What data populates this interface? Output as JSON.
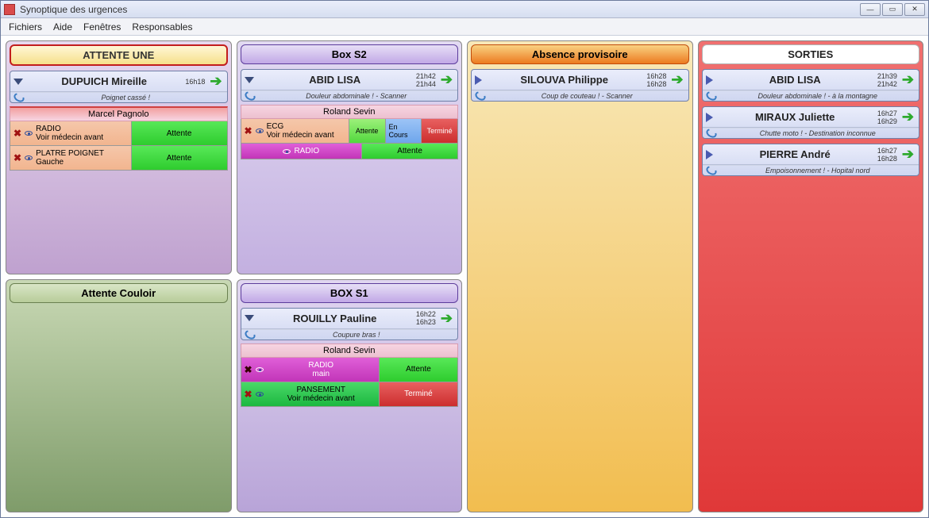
{
  "window": {
    "title": "Synoptique des urgences"
  },
  "menu": {
    "fichiers": "Fichiers",
    "aide": "Aide",
    "fenetres": "Fenêtres",
    "responsables": "Responsables"
  },
  "panels": {
    "attente_une": {
      "title": "ATTENTE UNE",
      "patient": {
        "name": "DUPUICH Mireille",
        "time1": "16h18",
        "detail": "Poignet cassé !"
      },
      "doctor": "Marcel Pagnolo",
      "tasks": [
        {
          "name": "RADIO",
          "sub": "Voir médecin avant",
          "status": "Attente",
          "type": "pink"
        },
        {
          "name": "PLATRE POIGNET",
          "sub": "Gauche",
          "status": "Attente",
          "type": "pink"
        }
      ]
    },
    "box_s2": {
      "title": "Box S2",
      "patient": {
        "name": "ABID LISA",
        "time1": "21h42",
        "time2": "21h44",
        "detail": "Douleur abdominale ! - Scanner"
      },
      "doctor": "Roland Sevin",
      "tasks": [
        {
          "name": "ECG",
          "sub": "Voir médecin avant",
          "statuses": [
            "Attente",
            "En Cours",
            "Terminé"
          ],
          "type": "pink-multi"
        },
        {
          "name": "RADIO",
          "sub": "",
          "status": "Attente",
          "type": "magenta"
        }
      ]
    },
    "absence": {
      "title": "Absence provisoire",
      "patient": {
        "name": "SILOUVA Philippe",
        "time1": "16h28",
        "time2": "16h28",
        "detail": "Coup de couteau ! - Scanner"
      }
    },
    "sorties": {
      "title": "SORTIES",
      "patients": [
        {
          "name": "ABID LISA",
          "time1": "21h39",
          "time2": "21h42",
          "detail": "Douleur abdominale ! - à la montagne"
        },
        {
          "name": "MIRAUX Juliette",
          "time1": "16h27",
          "time2": "16h29",
          "detail": "Chutte moto ! - Destination inconnue"
        },
        {
          "name": "PIERRE André",
          "time1": "16h27",
          "time2": "16h28",
          "detail": "Empoisonnement ! - Hopital nord"
        }
      ]
    },
    "attente_couloir": {
      "title": "Attente Couloir"
    },
    "box_s1": {
      "title": "BOX S1",
      "patient": {
        "name": "ROUILLY Pauline",
        "time1": "16h22",
        "time2": "16h23",
        "detail": "Coupure bras !"
      },
      "doctor": "Roland Sevin",
      "tasks": [
        {
          "name": "RADIO",
          "sub": "main",
          "status": "Attente",
          "type": "magenta"
        },
        {
          "name": "PANSEMENT",
          "sub": "Voir médecin avant",
          "status": "Terminé",
          "type": "green"
        }
      ]
    }
  }
}
